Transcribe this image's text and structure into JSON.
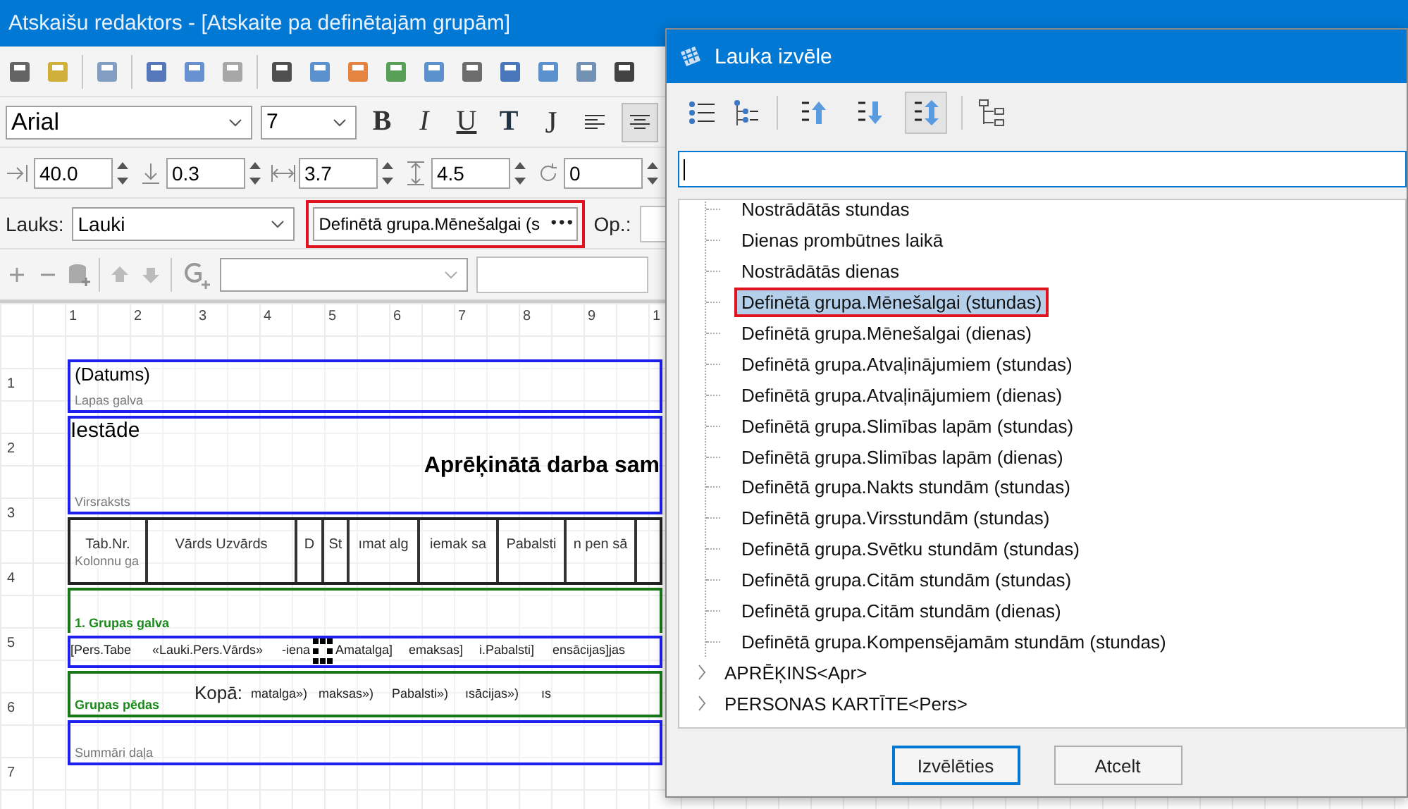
{
  "editor": {
    "title": "Atskaišu redaktors - [Atskaite pa definētajām grupām]",
    "font": {
      "family": "Arial",
      "size": "7"
    },
    "format_buttons": [
      {
        "label": "B",
        "kind": "bold"
      },
      {
        "label": "I",
        "kind": "italic"
      },
      {
        "label": "U",
        "kind": "underline"
      },
      {
        "label": "T",
        "kind": "shadow"
      },
      {
        "label": "J",
        "kind": "justify"
      }
    ],
    "align_buttons": [
      {
        "kind": "left",
        "selected": false
      },
      {
        "kind": "center",
        "selected": true
      }
    ],
    "spin_fields": [
      {
        "kind": "left",
        "value": "40.0"
      },
      {
        "kind": "top",
        "value": "0.3"
      },
      {
        "kind": "width",
        "value": "3.7"
      },
      {
        "kind": "height",
        "value": "4.5"
      },
      {
        "kind": "rotation",
        "value": "0"
      }
    ],
    "field_bar": {
      "label": "Lauks:",
      "source": "Lauki",
      "field": "Definētā grupa.Mēnešalgai (s",
      "browse": "•••",
      "highlighted": true,
      "op_label": "Op.:"
    },
    "ruler": {
      "columns": [
        "1",
        "2",
        "3",
        "4",
        "5",
        "6",
        "7",
        "8",
        "9",
        "1"
      ],
      "rows": [
        "1",
        "2",
        "3",
        "4",
        "5",
        "6",
        "7"
      ]
    },
    "bands": [
      {
        "kind": "page_header",
        "label": "Lapas galva",
        "texts": [
          "(Datums)"
        ]
      },
      {
        "kind": "title",
        "label": "Virsraksts",
        "texts": [
          "Iestāde",
          "Aprēķinātā darba sam"
        ]
      },
      {
        "kind": "column_header",
        "label": "Kolonnu ga",
        "texts": [
          "Tab.Nr.",
          "Vārds  Uzvārds",
          "D",
          "St",
          "ımat alg",
          "iemak sa",
          "Pabalsti",
          "n pen sā"
        ]
      },
      {
        "kind": "group_header",
        "label": "1. Grupas galva"
      },
      {
        "kind": "data",
        "texts": [
          "[Pers.Tabe",
          "«Lauki.Pers.Vārds»",
          "-iena",
          "Amatalga]",
          "emaksas]",
          "i.Pabalsti]",
          "ensācijas]jas"
        ]
      },
      {
        "kind": "group_footer",
        "label": "Grupas pēdas",
        "texts": [
          "Kopā:",
          "matalga»)",
          "maksas»)",
          "Pabalsti»)",
          "ısācijas»)",
          "ıs"
        ]
      },
      {
        "kind": "summary",
        "label": "Summāri daļa"
      }
    ]
  },
  "dialog": {
    "title": "Lauka izvēle",
    "sort_buttons": [
      {
        "kind": "asc",
        "selected": false
      },
      {
        "kind": "desc",
        "selected": false
      },
      {
        "kind": "none",
        "selected": true
      }
    ],
    "search": {
      "focused": true
    },
    "tree_items": [
      {
        "label": "Nostrādātās stundas",
        "selected": false,
        "highlighted": false
      },
      {
        "label": "Dienas prombūtnes laikā",
        "selected": false,
        "highlighted": false
      },
      {
        "label": "Nostrādātās dienas",
        "selected": false,
        "highlighted": false
      },
      {
        "label": "Definētā grupa.Mēnešalgai (stundas)",
        "selected": true,
        "highlighted": true
      },
      {
        "label": "Definētā grupa.Mēnešalgai (dienas)",
        "selected": false,
        "highlighted": false
      },
      {
        "label": "Definētā grupa.Atvaļinājumiem (stundas)",
        "selected": false,
        "highlighted": false
      },
      {
        "label": "Definētā grupa.Atvaļinājumiem (dienas)",
        "selected": false,
        "highlighted": false
      },
      {
        "label": "Definētā grupa.Slimības lapām (stundas)",
        "selected": false,
        "highlighted": false
      },
      {
        "label": "Definētā grupa.Slimības lapām (dienas)",
        "selected": false,
        "highlighted": false
      },
      {
        "label": "Definētā grupa.Nakts stundām (stundas)",
        "selected": false,
        "highlighted": false
      },
      {
        "label": "Definētā grupa.Virsstundām (stundas)",
        "selected": false,
        "highlighted": false
      },
      {
        "label": "Definētā grupa.Svētku stundām (stundas)",
        "selected": false,
        "highlighted": false
      },
      {
        "label": "Definētā grupa.Citām stundām (stundas)",
        "selected": false,
        "highlighted": false
      },
      {
        "label": "Definētā grupa.Citām stundām (dienas)",
        "selected": false,
        "highlighted": false
      },
      {
        "label": "Definētā grupa.Kompensējamām stundām (stundas)",
        "selected": false,
        "highlighted": false
      }
    ],
    "tree_groups": [
      {
        "label": "APRĒĶINS<Apr>",
        "expanded": false
      },
      {
        "label": "PERSONAS KARTĪTE<Pers>",
        "expanded": false
      }
    ],
    "buttons": [
      {
        "label": "Izvēlēties",
        "kind": "primary"
      },
      {
        "label": "Atcelt",
        "kind": "secondary"
      }
    ]
  }
}
